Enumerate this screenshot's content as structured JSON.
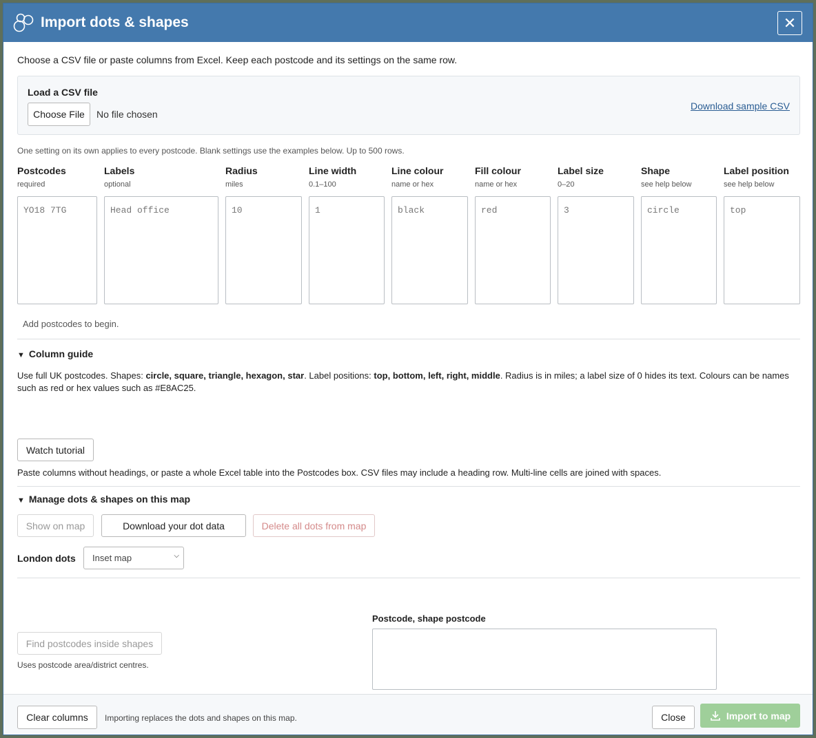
{
  "header": {
    "title": "Import dots & shapes",
    "close_glyph": "✕"
  },
  "intro": "Choose a CSV file or paste columns from Excel. Keep each postcode and its settings on the same row.",
  "csv": {
    "title": "Load a CSV file",
    "choose_label": "Choose File",
    "no_file": "No file chosen",
    "sample_link": "Download sample CSV"
  },
  "hint": "One setting on its own applies to every postcode. Blank settings use the examples below. Up to 500 rows.",
  "columns": [
    {
      "heading": "Postcodes",
      "sub": "required",
      "placeholder": "YO18 7TG"
    },
    {
      "heading": "Labels",
      "sub": "optional",
      "placeholder": "Head office"
    },
    {
      "heading": "Radius",
      "sub": "miles",
      "placeholder": "10"
    },
    {
      "heading": "Line width",
      "sub": "0.1–100",
      "placeholder": "1"
    },
    {
      "heading": "Line colour",
      "sub": "name or hex",
      "placeholder": "black"
    },
    {
      "heading": "Fill colour",
      "sub": "name or hex",
      "placeholder": "red"
    },
    {
      "heading": "Label size",
      "sub": "0–20",
      "placeholder": "3"
    },
    {
      "heading": "Shape",
      "sub": "see help below",
      "placeholder": "circle"
    },
    {
      "heading": "Label position",
      "sub": "see help below",
      "placeholder": "top"
    }
  ],
  "add_hint": "Add postcodes to begin.",
  "guide": {
    "title": "Column guide",
    "p1_a": "Use full UK postcodes. Shapes: ",
    "p1_b": "circle, square, triangle, hexagon, star",
    "p1_c": ". Label positions: ",
    "p1_d": "top, bottom, left, right, middle",
    "p1_e": ". Radius is in miles; a label size of 0 hides its text. Colours can be names such as red or hex values such as #E8AC25.",
    "tutorial_label": "Watch tutorial",
    "p2": "Paste columns without headings, or paste a whole Excel table into the Postcodes box. CSV files may include a heading row. Multi-line cells are joined with spaces."
  },
  "manage": {
    "title": "Manage dots & shapes on this map",
    "show_label": "Show on map",
    "download_label": "Download your dot data",
    "delete_label": "Delete all dots from map",
    "london_label": "London dots",
    "london_value": "Inset map"
  },
  "find": {
    "button_label": "Find postcodes inside shapes",
    "note": "Uses postcode area/district centres.",
    "box_label": "Postcode, shape postcode"
  },
  "footer": {
    "clear_label": "Clear columns",
    "note": "Importing replaces the dots and shapes on this map.",
    "close_label": "Close",
    "import_label": "Import to map"
  },
  "colors": {
    "header": "#4479ad",
    "import_disabled": "#9fcf9a",
    "link": "#2a5d93"
  }
}
